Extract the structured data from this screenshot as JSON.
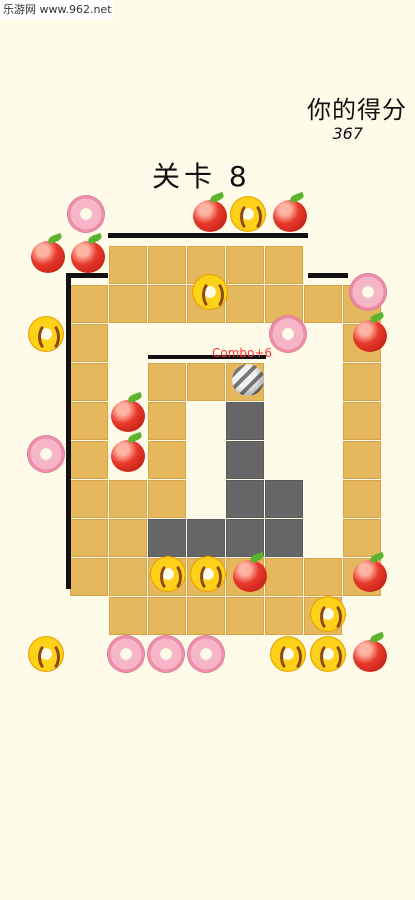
{
  "watermark": "乐游网 www.962.net",
  "score": {
    "label": "你的得分",
    "value": "367"
  },
  "level": {
    "label": "关卡 8"
  },
  "combo": "Combo+6",
  "icons": {
    "ball": "striped-ball-icon",
    "apple": "apple-icon",
    "donut_pink": "pink-donut-icon",
    "donut_yellow": "yellow-donut-icon"
  },
  "colors": {
    "background": "#fffbe9",
    "tile": "#e6b85e",
    "painted": "#666666",
    "combo": "#ff3333"
  }
}
